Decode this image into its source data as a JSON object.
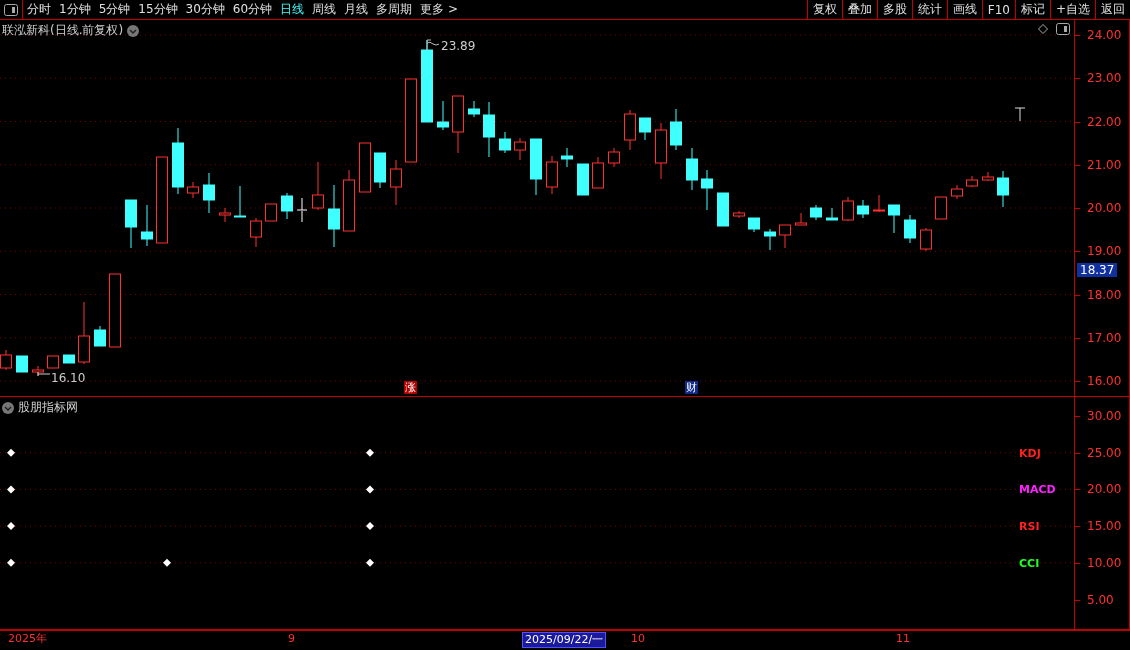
{
  "toolbar": {
    "periods": [
      {
        "label": "分时",
        "selected": false
      },
      {
        "label": "1分钟",
        "selected": false
      },
      {
        "label": "5分钟",
        "selected": false
      },
      {
        "label": "15分钟",
        "selected": false
      },
      {
        "label": "30分钟",
        "selected": false
      },
      {
        "label": "60分钟",
        "selected": false
      },
      {
        "label": "日线",
        "selected": true
      },
      {
        "label": "周线",
        "selected": false
      },
      {
        "label": "月线",
        "selected": false
      },
      {
        "label": "多周期",
        "selected": false
      },
      {
        "label": "更多 >",
        "selected": false
      }
    ],
    "buttons": [
      "复权",
      "叠加",
      "多股",
      "统计",
      "画线",
      "F10",
      "标记",
      "+自选",
      "返回"
    ]
  },
  "main_chart": {
    "title": "联泓新科(日线.前复权)",
    "high_label": "23.89",
    "low_label": "16.10",
    "markers": [
      {
        "text": "涨",
        "color": "#b00000"
      },
      {
        "text": "财",
        "color": "#102a8a"
      }
    ],
    "y_ticks": [
      "24.00",
      "23.00",
      "22.00",
      "21.00",
      "20.00",
      "19.00",
      "18.00",
      "17.00",
      "16.00"
    ],
    "current_price": "18.37"
  },
  "indicator_panel": {
    "title": "股朋指标网",
    "rows": [
      {
        "label": "KDJ",
        "color": "#ff2020"
      },
      {
        "label": "MACD",
        "color": "#ff20ff"
      },
      {
        "label": "RSI",
        "color": "#ff2020"
      },
      {
        "label": "CCI",
        "color": "#20ff20"
      }
    ],
    "y_ticks": [
      "30.00",
      "25.00",
      "20.00",
      "15.00",
      "10.00",
      "5.00"
    ]
  },
  "time_axis": {
    "labels": [
      {
        "text": "2025年",
        "selected": false
      },
      {
        "text": "9",
        "selected": false
      },
      {
        "text": "2025/09/22/一",
        "selected": true
      },
      {
        "text": "10",
        "selected": false
      },
      {
        "text": "11",
        "selected": false
      }
    ]
  }
}
